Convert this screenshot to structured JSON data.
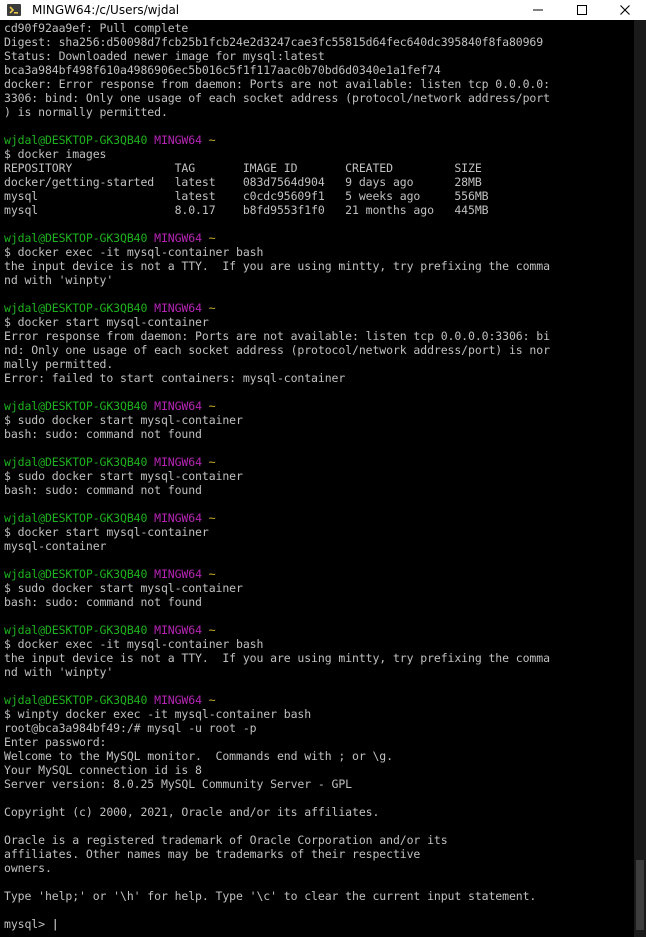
{
  "window": {
    "title": "MINGW64:/c/Users/wjdal"
  },
  "prompt": {
    "user_host": "wjdal@DESKTOP-GK3QB40",
    "system": "MINGW64",
    "path": "~"
  },
  "terminal_lines": [
    {
      "kind": "text",
      "text": "cd90f92aa9ef: Pull complete"
    },
    {
      "kind": "text",
      "text": "Digest: sha256:d50098d7fcb25b1fcb24e2d3247cae3fc55815d64fec640dc395840f8fa80969"
    },
    {
      "kind": "text",
      "text": "Status: Downloaded newer image for mysql:latest"
    },
    {
      "kind": "text",
      "text": "bca3a984bf498f610a4986906ec5b016c5f1f117aac0b70bd6d0340e1a1fef74"
    },
    {
      "kind": "text",
      "text": "docker: Error response from daemon: Ports are not available: listen tcp 0.0.0.0:"
    },
    {
      "kind": "text",
      "text": "3306: bind: Only one usage of each socket address (protocol/network address/port"
    },
    {
      "kind": "text",
      "text": ") is normally permitted."
    },
    {
      "kind": "text",
      "text": ""
    },
    {
      "kind": "prompt"
    },
    {
      "kind": "text",
      "text": "$ docker images"
    },
    {
      "kind": "text",
      "text": "REPOSITORY               TAG       IMAGE ID       CREATED         SIZE"
    },
    {
      "kind": "text",
      "text": "docker/getting-started   latest    083d7564d904   9 days ago      28MB"
    },
    {
      "kind": "text",
      "text": "mysql                    latest    c0cdc95609f1   5 weeks ago     556MB"
    },
    {
      "kind": "text",
      "text": "mysql                    8.0.17    b8fd9553f1f0   21 months ago   445MB"
    },
    {
      "kind": "text",
      "text": ""
    },
    {
      "kind": "prompt"
    },
    {
      "kind": "text",
      "text": "$ docker exec -it mysql-container bash"
    },
    {
      "kind": "text",
      "text": "the input device is not a TTY.  If you are using mintty, try prefixing the comma"
    },
    {
      "kind": "text",
      "text": "nd with 'winpty'"
    },
    {
      "kind": "text",
      "text": ""
    },
    {
      "kind": "prompt"
    },
    {
      "kind": "text",
      "text": "$ docker start mysql-container"
    },
    {
      "kind": "text",
      "text": "Error response from daemon: Ports are not available: listen tcp 0.0.0.0:3306: bi"
    },
    {
      "kind": "text",
      "text": "nd: Only one usage of each socket address (protocol/network address/port) is nor"
    },
    {
      "kind": "text",
      "text": "mally permitted."
    },
    {
      "kind": "text",
      "text": "Error: failed to start containers: mysql-container"
    },
    {
      "kind": "text",
      "text": ""
    },
    {
      "kind": "prompt"
    },
    {
      "kind": "text",
      "text": "$ sudo docker start mysql-container"
    },
    {
      "kind": "text",
      "text": "bash: sudo: command not found"
    },
    {
      "kind": "text",
      "text": ""
    },
    {
      "kind": "prompt"
    },
    {
      "kind": "text",
      "text": "$ sudo docker start mysql-container"
    },
    {
      "kind": "text",
      "text": "bash: sudo: command not found"
    },
    {
      "kind": "text",
      "text": ""
    },
    {
      "kind": "prompt"
    },
    {
      "kind": "text",
      "text": "$ docker start mysql-container"
    },
    {
      "kind": "text",
      "text": "mysql-container"
    },
    {
      "kind": "text",
      "text": ""
    },
    {
      "kind": "prompt"
    },
    {
      "kind": "text",
      "text": "$ sudo docker start mysql-container"
    },
    {
      "kind": "text",
      "text": "bash: sudo: command not found"
    },
    {
      "kind": "text",
      "text": ""
    },
    {
      "kind": "prompt"
    },
    {
      "kind": "text",
      "text": "$ docker exec -it mysql-container bash"
    },
    {
      "kind": "text",
      "text": "the input device is not a TTY.  If you are using mintty, try prefixing the comma"
    },
    {
      "kind": "text",
      "text": "nd with 'winpty'"
    },
    {
      "kind": "text",
      "text": ""
    },
    {
      "kind": "prompt"
    },
    {
      "kind": "text",
      "text": "$ winpty docker exec -it mysql-container bash"
    },
    {
      "kind": "text",
      "text": "root@bca3a984bf49:/# mysql -u root -p"
    },
    {
      "kind": "text",
      "text": "Enter password:"
    },
    {
      "kind": "text",
      "text": "Welcome to the MySQL monitor.  Commands end with ; or \\g."
    },
    {
      "kind": "text",
      "text": "Your MySQL connection id is 8"
    },
    {
      "kind": "text",
      "text": "Server version: 8.0.25 MySQL Community Server - GPL"
    },
    {
      "kind": "text",
      "text": ""
    },
    {
      "kind": "text",
      "text": "Copyright (c) 2000, 2021, Oracle and/or its affiliates."
    },
    {
      "kind": "text",
      "text": ""
    },
    {
      "kind": "text",
      "text": "Oracle is a registered trademark of Oracle Corporation and/or its"
    },
    {
      "kind": "text",
      "text": "affiliates. Other names may be trademarks of their respective"
    },
    {
      "kind": "text",
      "text": "owners."
    },
    {
      "kind": "text",
      "text": ""
    },
    {
      "kind": "text",
      "text": "Type 'help;' or '\\h' for help. Type '\\c' to clear the current input statement."
    },
    {
      "kind": "text",
      "text": ""
    },
    {
      "kind": "input",
      "text": "mysql> ",
      "cursor": "|"
    }
  ],
  "colors": {
    "background": "#000000",
    "text": "#c0c0c0",
    "prompt_user": "#1eb31e",
    "prompt_system": "#b625b6",
    "prompt_path": "#c8b22c"
  },
  "icons": {
    "app": "mintty-terminal-icon",
    "minimize": "minimize-icon",
    "maximize": "maximize-icon",
    "close": "close-icon"
  }
}
